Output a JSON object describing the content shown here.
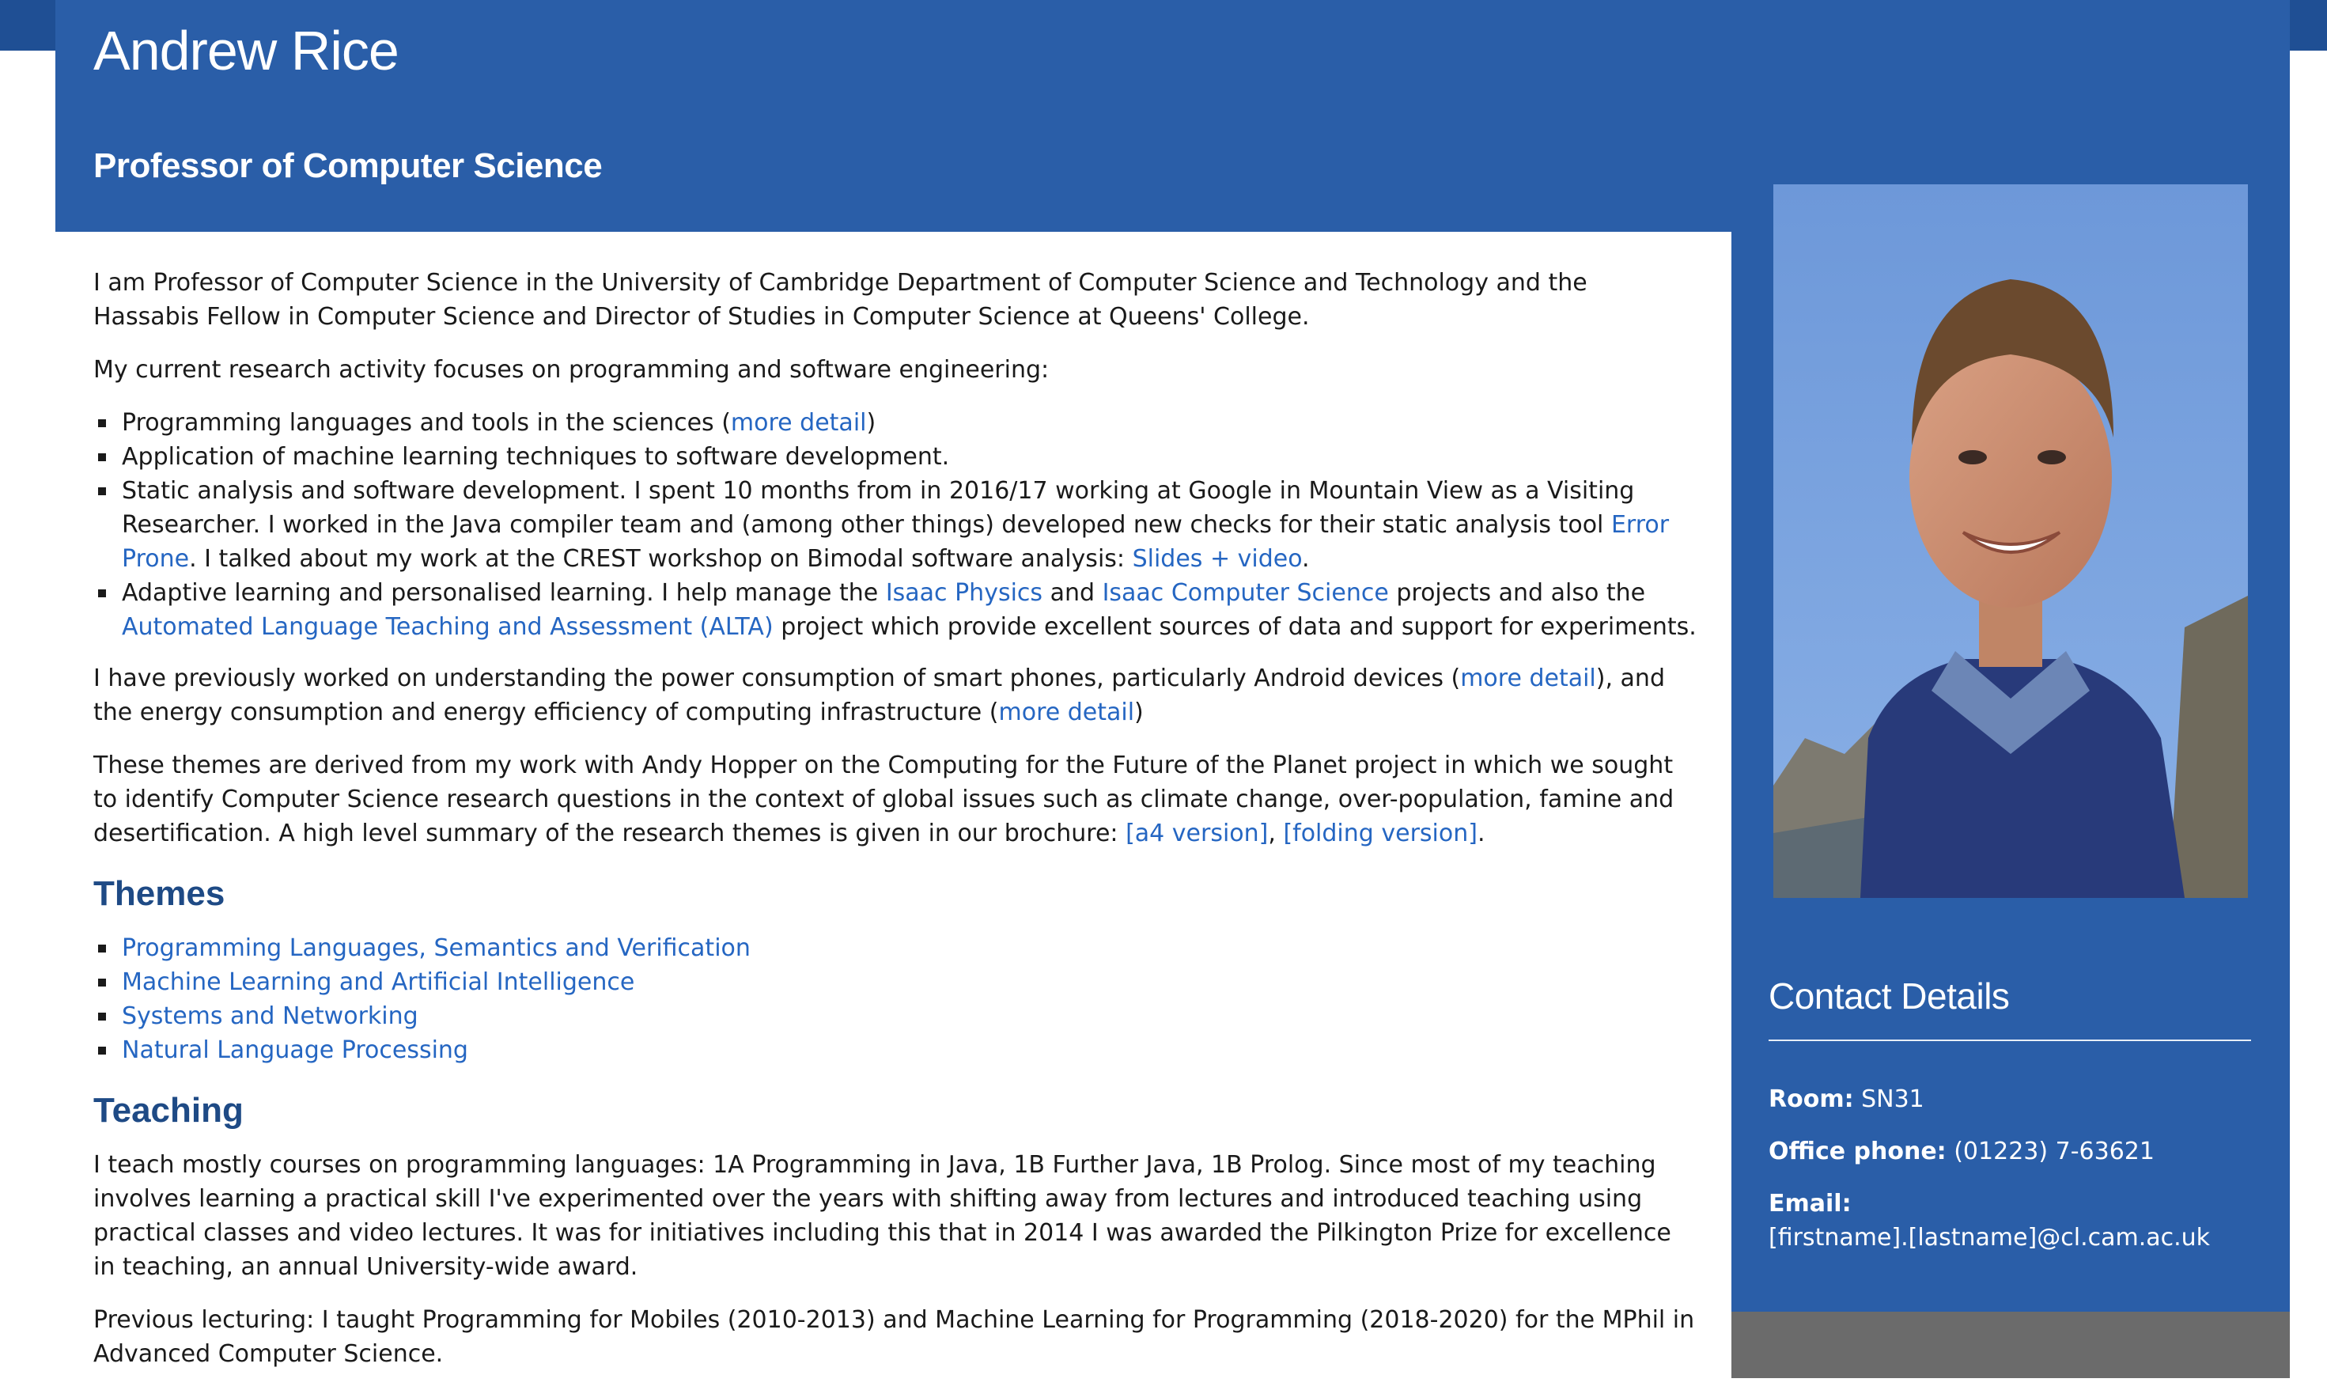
{
  "header": {
    "name": "Andrew Rice",
    "subtitle": "Professor of Computer Science"
  },
  "intro": {
    "p1": "I am Professor of Computer Science in the University of Cambridge Department of Computer Science and Technology and the Hassabis Fellow in Computer Science and Director of Studies in Computer Science at Queens' College.",
    "p2": "My current research activity focuses on programming and software engineering:"
  },
  "research": {
    "item1_text": "Programming languages and tools in the sciences (",
    "item1_link": "more detail",
    "item1_end": ")",
    "item2_text": "Application of machine learning techniques to software development.",
    "item3_text": "Static analysis and software development. I spent 10 months from in 2016/17 working at Google in Mountain View as a Visiting Researcher. I worked in the Java compiler team and (among other things) developed new checks for their static analysis tool ",
    "item3_link1": "Error Prone",
    "item3_mid": ". I talked about my work at the CREST workshop on Bimodal software analysis: ",
    "item3_link2": "Slides + video",
    "item3_end": ".",
    "item4_text": "Adaptive learning and personalised learning. I help manage the ",
    "item4_link1": "Isaac Physics",
    "item4_and": " and ",
    "item4_link2": "Isaac Computer Science",
    "item4_mid": " projects and also the ",
    "item4_link3": "Automated Language Teaching and Assessment (ALTA)",
    "item4_end": " project which provide excellent sources of data and support for experiments."
  },
  "previous": {
    "text1": "I have previously worked on understanding the power consumption of smart phones, particularly Android devices (",
    "link1": "more detail",
    "text2": "), and the energy consumption and energy efficiency of computing infrastructure (",
    "link2": "more detail",
    "text3": ")"
  },
  "themes_para": {
    "text": "These themes are derived from my work with Andy Hopper on the Computing for the Future of the Planet project in which we sought to identify Computer Science research questions in the context of global issues such as climate change, over-population, famine and desertification. A high level summary of the research themes is given in our brochure: ",
    "link1": "[a4 version]",
    "sep": ", ",
    "link2": "[folding version]",
    "end": "."
  },
  "themes": {
    "heading": "Themes",
    "items": [
      "Programming Languages, Semantics and Verification",
      "Machine Learning and Artificial Intelligence",
      "Systems and Networking",
      "Natural Language Processing"
    ]
  },
  "teaching": {
    "heading": "Teaching",
    "p1": "I teach mostly courses on programming languages: 1A Programming in Java, 1B Further Java, 1B Prolog. Since most of my teaching involves learning a practical skill I've experimented over the years with shifting away from lectures and introduced teaching using practical classes and video lectures. It was for initiatives including this that in 2014 I was awarded the Pilkington Prize for excellence in teaching, an annual University-wide award.",
    "p2": "Previous lecturing: I taught Programming for Mobiles (2010-2013) and Machine Learning for Programming (2018-2020) for the MPhil in Advanced Computer Science."
  },
  "contact": {
    "title": "Contact Details",
    "room_label": "Room:",
    "room_value": " SN31",
    "phone_label": "Office phone:",
    "phone_value": " (01223) 7-63621",
    "email_label": "Email:",
    "email_value": "[firstname].[lastname]@cl.cam.ac.uk"
  },
  "colors": {
    "header_blue": "#2a5ea8",
    "link_blue": "#2566c2",
    "heading_blue": "#1e4a85",
    "footer_gray": "#6b6b6b"
  }
}
